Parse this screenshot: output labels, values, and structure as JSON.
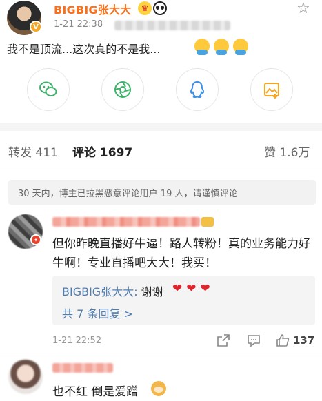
{
  "post": {
    "author": "BIGBIG张大大",
    "avatar_badge": "V",
    "timestamp": "1-21 22:38",
    "text": "我不是顶流...这次真的不是我...",
    "icons": [
      "crown-icon",
      "panda-icon",
      "star-icon",
      "crying-emoji"
    ]
  },
  "share": {
    "buttons": [
      "wechat-icon",
      "moments-icon",
      "qq-icon",
      "save-image-icon"
    ],
    "colors": {
      "green": "#3db16a",
      "blue": "#3f8fe6",
      "orange": "#f5a623"
    }
  },
  "tabs": {
    "repost": "转发 411",
    "comments": "评论 1697",
    "likes": "赞 1.6万"
  },
  "notice": "30 天内，博主已拉黑恶意评论用户 19 人，请谨慎评论",
  "comment1": {
    "text": "但你昨晚直播好牛逼！路人转粉！真的业务能力好牛啊！专业直播吧大大！我买！",
    "reply_author": "BIGBIG张大大:",
    "reply_text": " 谢谢",
    "reply_more": "共 7 条回复 >",
    "time": "1-21 22:52",
    "likes": "137"
  },
  "comment2": {
    "text": "也不红 倒是爱蹭"
  },
  "colors": {
    "accent": "#f86f1c",
    "link": "#507daf"
  }
}
